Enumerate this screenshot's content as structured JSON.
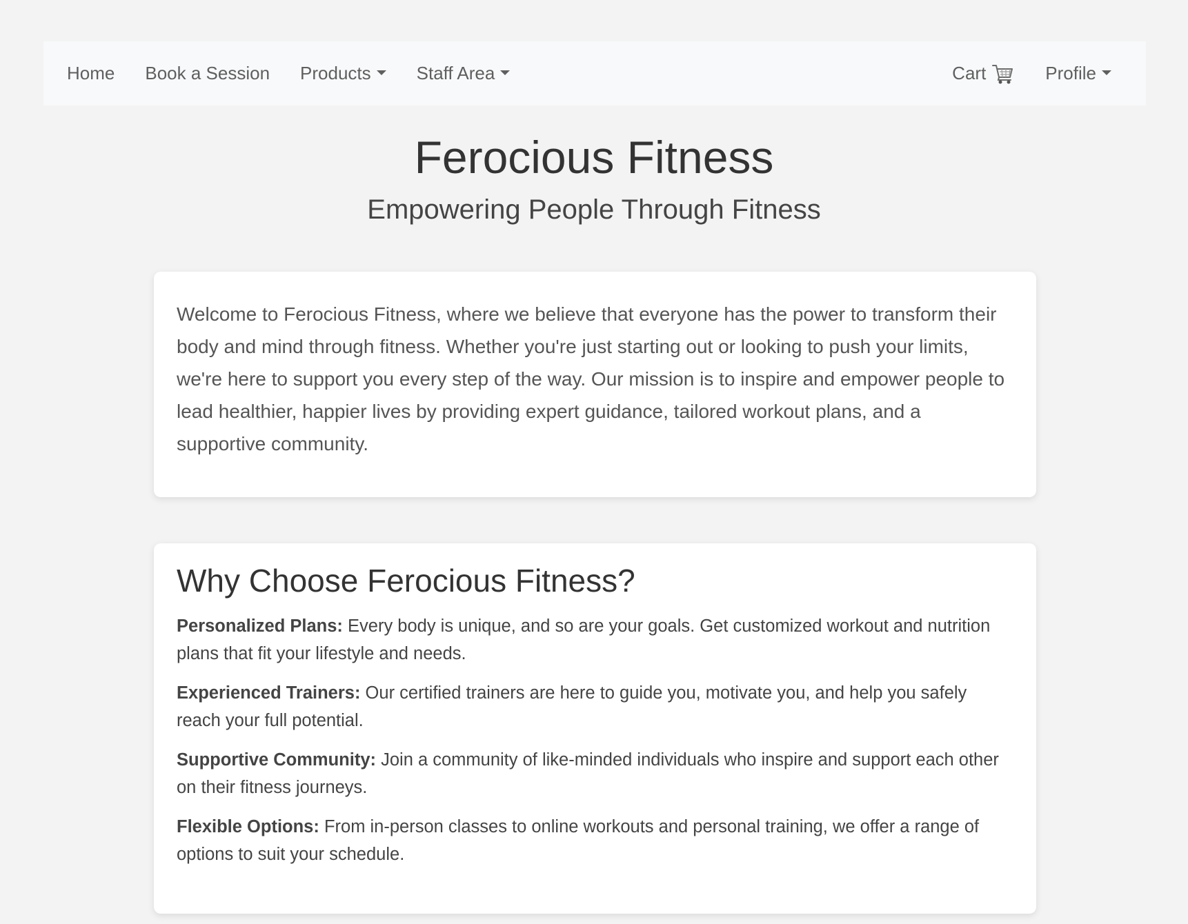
{
  "nav": {
    "left": [
      {
        "label": "Home",
        "dropdown": false
      },
      {
        "label": "Book a Session",
        "dropdown": false
      },
      {
        "label": "Products",
        "dropdown": true
      },
      {
        "label": "Staff Area",
        "dropdown": true
      }
    ],
    "cart": {
      "label": "Cart",
      "icon": "shopping-cart-icon"
    },
    "profile": {
      "label": "Profile",
      "dropdown": true
    }
  },
  "hero": {
    "title": "Ferocious Fitness",
    "subtitle": "Empowering People Through Fitness"
  },
  "intro": {
    "text": "Welcome to Ferocious Fitness, where we believe that everyone has the power to transform their body and mind through fitness. Whether you're just starting out or looking to push your limits, we're here to support you every step of the way. Our mission is to inspire and empower people to lead healthier, happier lives by providing expert guidance, tailored workout plans, and a supportive community."
  },
  "why": {
    "heading": "Why Choose Ferocious Fitness?",
    "features": [
      {
        "title": "Personalized Plans:",
        "text": " Every body is unique, and so are your goals. Get customized workout and nutrition plans that fit your lifestyle and needs."
      },
      {
        "title": "Experienced Trainers:",
        "text": " Our certified trainers are here to guide you, motivate you, and help you safely reach your full potential."
      },
      {
        "title": "Supportive Community:",
        "text": " Join a community of like-minded individuals who inspire and support each other on their fitness journeys."
      },
      {
        "title": "Flexible Options:",
        "text": " From in-person classes to online workouts and personal training, we offer a range of options to suit your schedule."
      }
    ]
  },
  "colors": {
    "page_background": "#f3f3f3",
    "navbar_background": "#f8f9fa",
    "card_background": "#ffffff",
    "nav_text": "#5f5f5f"
  }
}
